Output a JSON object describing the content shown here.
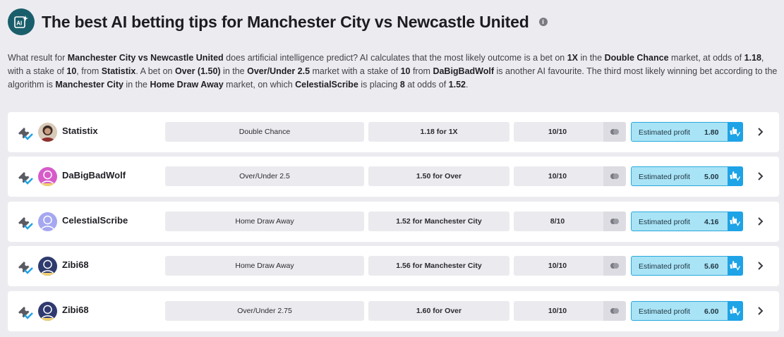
{
  "page": {
    "title": "The best AI betting tips for Manchester City vs Newcastle United",
    "logo_text": "AI"
  },
  "intro": {
    "s1": "What result for ",
    "b1": "Manchester City vs Newcastle United",
    "s2": " does artificial intelligence predict? AI calculates that the most likely outcome is a bet on ",
    "b2": "1X",
    "s3": " in the ",
    "b3": "Double Chance",
    "s4": " market, at odds of ",
    "b4": "1.18",
    "s5": ", with a stake of ",
    "b5": "10",
    "s6": ", from ",
    "b6": "Statistix",
    "s7": ". A bet on ",
    "b7": "Over (1.50)",
    "s8": " in the ",
    "b8": "Over/Under 2.5",
    "s9": " market with a stake of ",
    "b9": "10",
    "s10": " from ",
    "b10": "DaBigBadWolf",
    "s11": " is another AI favourite. The third most likely winning bet according to the algorithm is ",
    "b11": "Manchester City",
    "s12": " in the ",
    "b12": "Home Draw Away",
    "s13": " market, on which ",
    "b13": "CelestialScribe",
    "s14": " is placing ",
    "b14": "8",
    "s15": " at odds of ",
    "b15": "1.52",
    "s16": "."
  },
  "profit_label": "Estimated profit",
  "colors": {
    "accent_blue": "#1ea3e6",
    "profit_bg": "#a9e3f6",
    "logo_teal": "#1a5e6b"
  },
  "tips": [
    {
      "tipster": "Statistix",
      "avatar": "photo",
      "market": "Double Chance",
      "odds": "1.18 for 1X",
      "stake": "10/10",
      "profit": "1.80"
    },
    {
      "tipster": "DaBigBadWolf",
      "avatar": "pink-user",
      "market": "Over/Under 2.5",
      "odds": "1.50 for Over",
      "stake": "10/10",
      "profit": "5.00"
    },
    {
      "tipster": "CelestialScribe",
      "avatar": "lavender-user",
      "market": "Home Draw Away",
      "odds": "1.52 for Manchester City",
      "stake": "8/10",
      "profit": "4.16"
    },
    {
      "tipster": "Zibi68",
      "avatar": "navy-user",
      "market": "Home Draw Away",
      "odds": "1.56 for Manchester City",
      "stake": "10/10",
      "profit": "5.60"
    },
    {
      "tipster": "Zibi68",
      "avatar": "navy-user",
      "market": "Over/Under 2.75",
      "odds": "1.60 for Over",
      "stake": "10/10",
      "profit": "6.00"
    }
  ]
}
